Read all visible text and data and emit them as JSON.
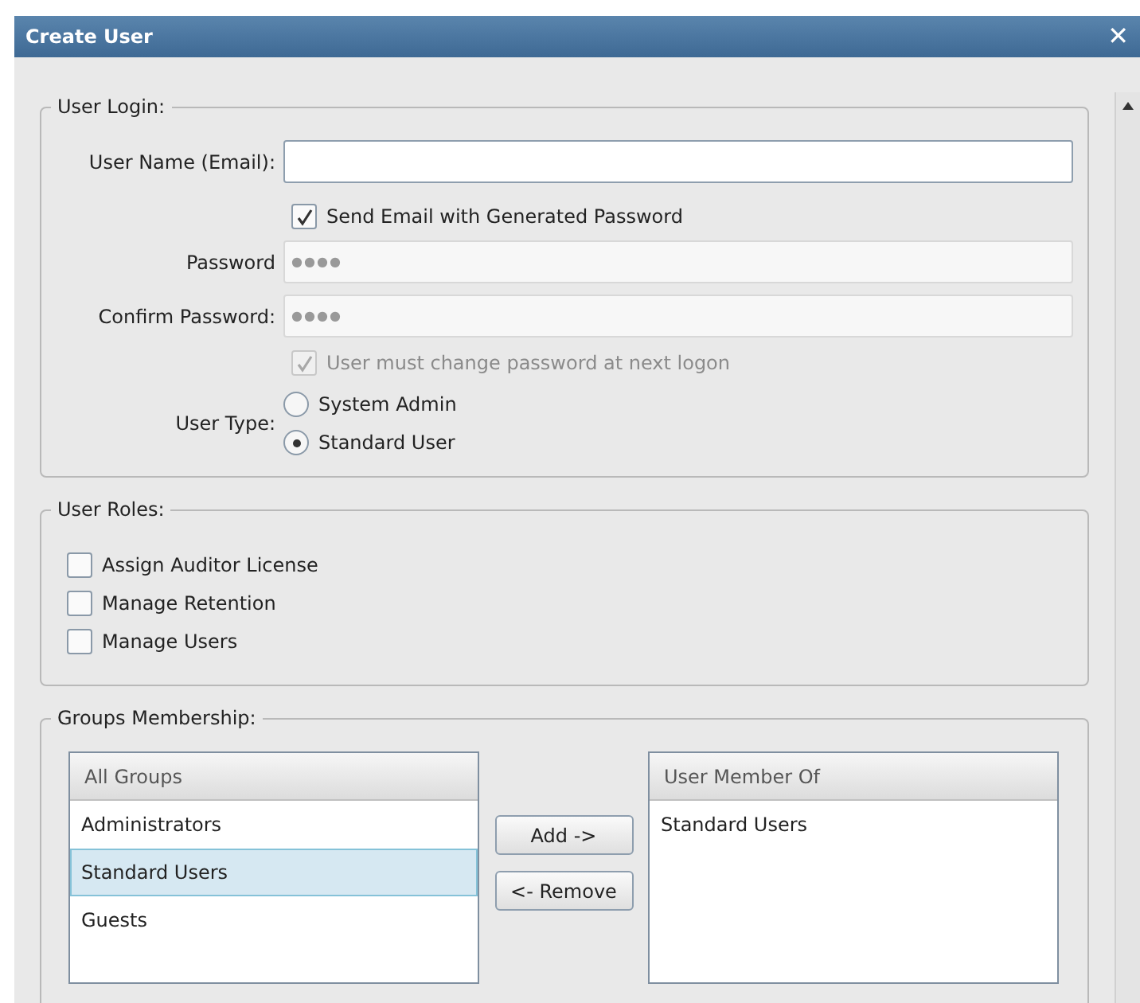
{
  "window": {
    "title": "Create User",
    "close": "✕"
  },
  "user_login": {
    "legend": "User Login:",
    "username": {
      "label": "User Name (Email):",
      "disabled": false
    },
    "send_email": {
      "label": "Send Email with Generated Password",
      "checked": true,
      "disabled": false
    },
    "password": {
      "label": "Password",
      "value": "●●●●",
      "disabled": true
    },
    "confirm_password": {
      "label": "Confirm Password:",
      "value": "●●●●",
      "disabled": true
    },
    "must_change": {
      "label": "User must change password at next logon",
      "checked": true,
      "disabled": true
    },
    "user_type": {
      "label": "User Type:",
      "options": [
        {
          "label": "System Admin",
          "selected": false
        },
        {
          "label": "Standard User",
          "selected": true
        }
      ]
    }
  },
  "user_roles": {
    "legend": "User Roles:",
    "items": [
      {
        "label": "Assign Auditor License",
        "checked": false
      },
      {
        "label": "Manage Retention",
        "checked": false
      },
      {
        "label": "Manage Users",
        "checked": false
      }
    ]
  },
  "groups": {
    "legend": "Groups Membership:",
    "all_groups": {
      "header": "All Groups",
      "items": [
        {
          "label": "Administrators",
          "selected": false
        },
        {
          "label": "Standard Users",
          "selected": true
        },
        {
          "label": "Guests",
          "selected": false
        }
      ]
    },
    "buttons": [
      "Add ->",
      "<- Remove"
    ],
    "member_of": {
      "header": "User Member Of",
      "items": [
        {
          "label": "Standard Users",
          "selected": false
        }
      ]
    }
  }
}
